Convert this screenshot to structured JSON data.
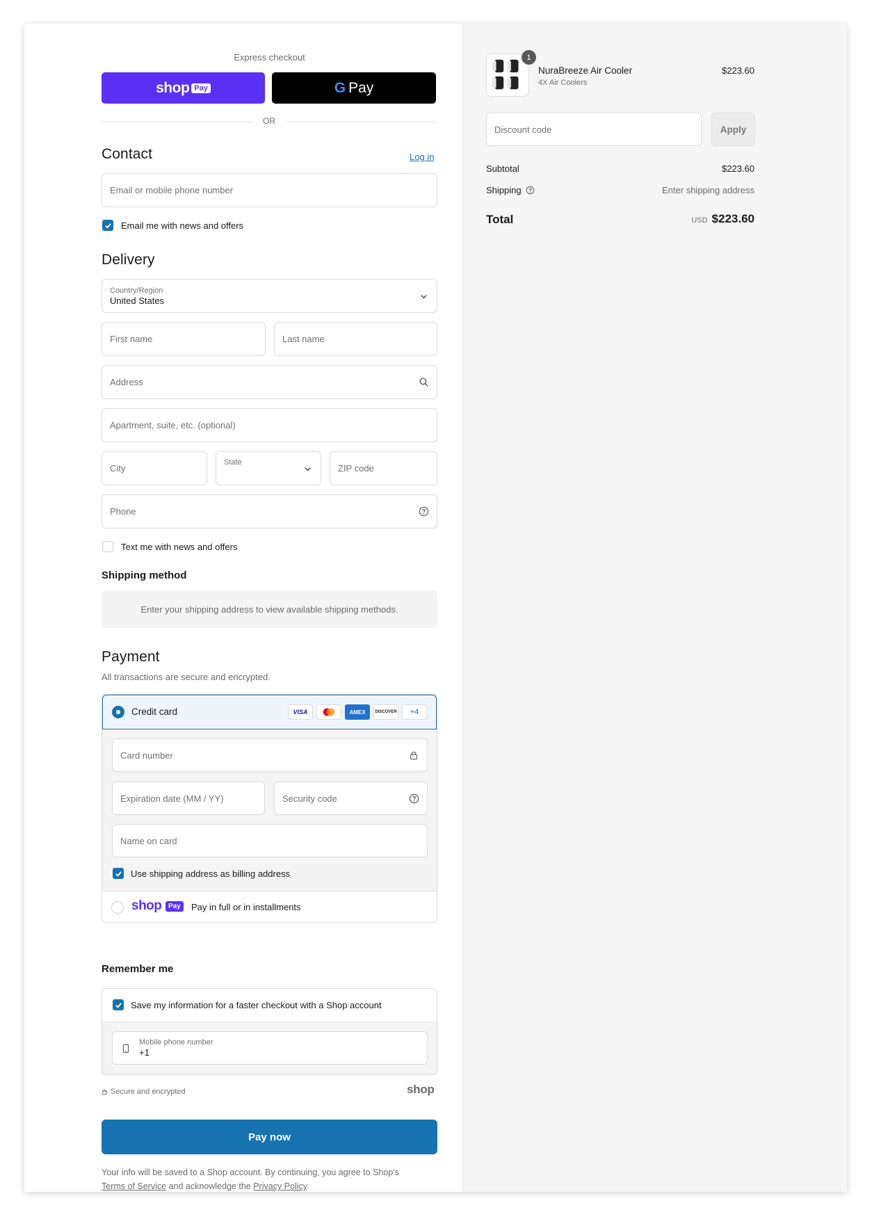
{
  "express": {
    "title": "Express checkout",
    "shop_pay_word": "shop",
    "shop_pay_badge": "Pay",
    "gpay_letter": "G",
    "gpay_word": "Pay",
    "or_text": "OR"
  },
  "contact": {
    "heading": "Contact",
    "login_link": "Log in",
    "email_placeholder": "Email or mobile phone number",
    "news_checkbox_label": "Email me with news and offers"
  },
  "delivery": {
    "heading": "Delivery",
    "country_label": "Country/Region",
    "country_value": "United States",
    "first_name_placeholder": "First name",
    "last_name_placeholder": "Last name",
    "address_placeholder": "Address",
    "apartment_placeholder": "Apartment, suite, etc. (optional)",
    "city_placeholder": "City",
    "state_label": "State",
    "zip_placeholder": "ZIP code",
    "phone_placeholder": "Phone",
    "text_checkbox_label": "Text me with news and offers"
  },
  "shipping_method": {
    "heading": "Shipping method",
    "message": "Enter your shipping address to view available shipping methods."
  },
  "payment": {
    "heading": "Payment",
    "subtitle": "All transactions are secure and encrypted.",
    "credit_card_label": "Credit card",
    "card_logos": [
      "VISA",
      "AMEX",
      "DISCOVER"
    ],
    "more_cards": "+4",
    "card_number_placeholder": "Card number",
    "expiration_placeholder": "Expiration date (MM / YY)",
    "security_code_placeholder": "Security code",
    "name_on_card_placeholder": "Name on card",
    "billing_checkbox_label": "Use shipping address as billing address",
    "shop_pay_word": "shop",
    "shop_pay_badge": "Pay",
    "shop_pay_label": "Pay in full or in installments"
  },
  "remember": {
    "heading": "Remember me",
    "save_label": "Save my information for a faster checkout with a Shop account",
    "mobile_label": "Mobile phone number",
    "mobile_value": "+1",
    "secure_text": "Secure and encrypted",
    "shop_logo": "shop"
  },
  "pay_now": {
    "label": "Pay now"
  },
  "legal": {
    "text_before": "Your info will be saved to a Shop account. By continuing, you agree to Shop's",
    "terms_link": "Terms of Service",
    "text_middle": "and acknowledge the",
    "privacy_link": "Privacy Policy",
    "text_end": "."
  },
  "summary": {
    "item_name": "NuraBreeze Air Cooler",
    "item_variant": "4X Air Coolers",
    "item_price": "$223.60",
    "item_quantity": "1",
    "discount_placeholder": "Discount code",
    "apply_label": "Apply",
    "subtotal_label": "Subtotal",
    "subtotal_value": "$223.60",
    "shipping_label": "Shipping",
    "shipping_value": "Enter shipping address",
    "total_label": "Total",
    "total_currency": "USD",
    "total_value": "$223.60"
  },
  "colors": {
    "accent": "#1773b0",
    "shop_pay_purple": "#5a31f4",
    "right_panel_bg": "#f5f5f5"
  },
  "icons": [
    "search-icon",
    "help-circle-icon",
    "lock-icon",
    "chevron-down-icon",
    "checkmark-icon",
    "phone-icon",
    "padlock-small-icon"
  ]
}
